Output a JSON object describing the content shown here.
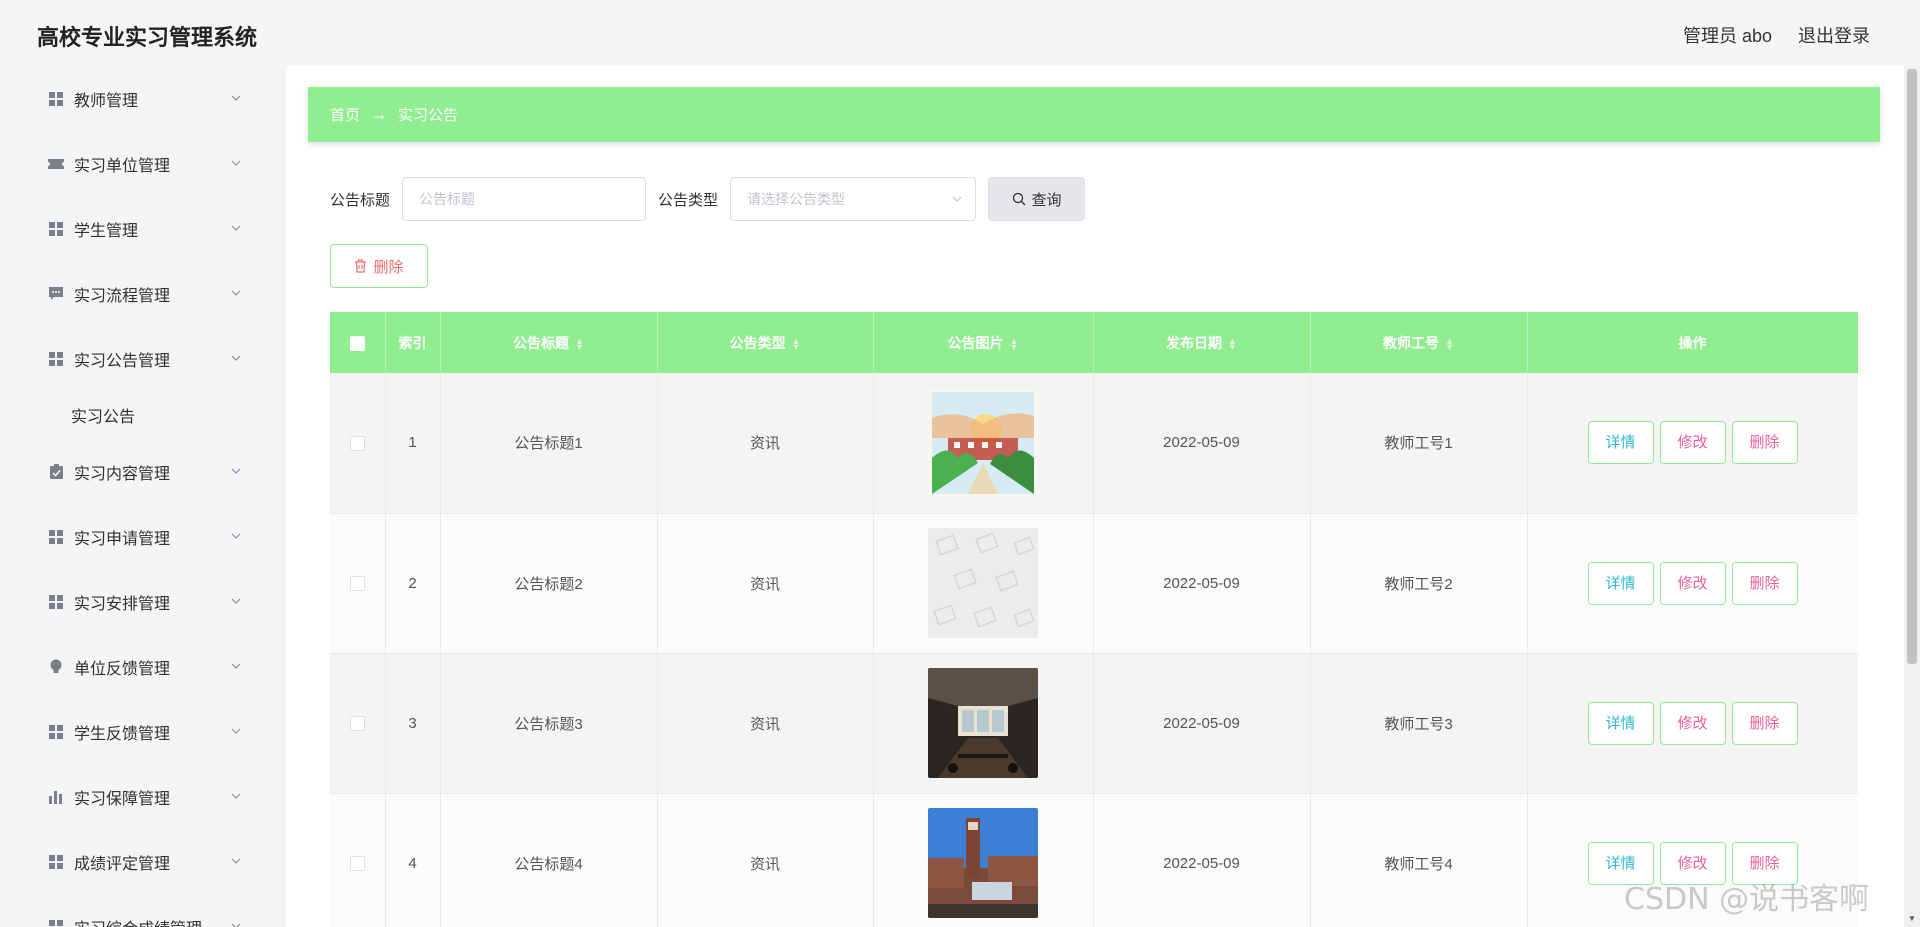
{
  "header": {
    "title": "高校专业实习管理系统",
    "user": "管理员 abo",
    "logout": "退出登录"
  },
  "sidebar": {
    "items": [
      {
        "label": "教师管理",
        "icon": "grid-icon"
      },
      {
        "label": "实习单位管理",
        "icon": "ticket-icon"
      },
      {
        "label": "学生管理",
        "icon": "grid-icon"
      },
      {
        "label": "实习流程管理",
        "icon": "chat-icon"
      },
      {
        "label": "实习公告管理",
        "icon": "grid-icon"
      },
      {
        "label": "实习内容管理",
        "icon": "clipboard-icon"
      },
      {
        "label": "实习申请管理",
        "icon": "grid-icon"
      },
      {
        "label": "实习安排管理",
        "icon": "grid-icon"
      },
      {
        "label": "单位反馈管理",
        "icon": "bulb-icon"
      },
      {
        "label": "学生反馈管理",
        "icon": "grid-icon"
      },
      {
        "label": "实习保障管理",
        "icon": "bar-chart-icon"
      },
      {
        "label": "成绩评定管理",
        "icon": "grid-icon"
      },
      {
        "label": "实习综合成绩管理",
        "icon": "grid-icon"
      }
    ],
    "submenu": {
      "label": "实习公告"
    }
  },
  "breadcrumb": {
    "home": "首页",
    "arrow": "→",
    "current": "实习公告"
  },
  "search": {
    "title_label": "公告标题",
    "title_placeholder": "公告标题",
    "type_label": "公告类型",
    "type_placeholder": "请选择公告类型",
    "query_button": "查询"
  },
  "toolbar": {
    "delete_button": "删除"
  },
  "table": {
    "headers": {
      "index": "索引",
      "title": "公告标题",
      "type": "公告类型",
      "image": "公告图片",
      "date": "发布日期",
      "teacher": "教师工号",
      "actions": "操作"
    },
    "actions": {
      "detail": "详情",
      "edit": "修改",
      "delete": "删除"
    },
    "rows": [
      {
        "index": "1",
        "title": "公告标题1",
        "type": "资讯",
        "image": "campus-painting",
        "date": "2022-05-09",
        "teacher": "教师工号1"
      },
      {
        "index": "2",
        "title": "公告标题2",
        "type": "资讯",
        "image": "placeholder",
        "date": "2022-05-09",
        "teacher": "教师工号2"
      },
      {
        "index": "3",
        "title": "公告标题3",
        "type": "资讯",
        "image": "meeting-room",
        "date": "2022-05-09",
        "teacher": "教师工号3"
      },
      {
        "index": "4",
        "title": "公告标题4",
        "type": "资讯",
        "image": "building-photo",
        "date": "2022-05-09",
        "teacher": "教师工号4"
      }
    ]
  },
  "watermark": "CSDN @说书客啊",
  "colors": {
    "accent": "#90ee90",
    "danger": "#f56c6c",
    "detail": "#2fb9d1",
    "edit": "#f0609a"
  }
}
